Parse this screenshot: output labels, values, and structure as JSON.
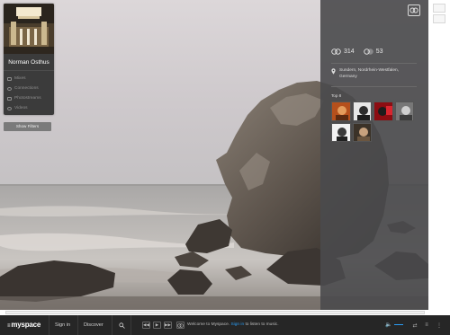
{
  "colors": {
    "accent": "#2a9df4",
    "panel": "#4a4a4c",
    "bar": "#262626"
  },
  "profile": {
    "name": "Norman Osthus",
    "menu": [
      {
        "label": "Mixes",
        "icon": "mixes-icon"
      },
      {
        "label": "Connections",
        "icon": "connections-icon"
      },
      {
        "label": "Photostreams",
        "icon": "photostreams-icon"
      },
      {
        "label": "Videos",
        "icon": "videos-icon"
      }
    ],
    "show_filters": "Show Filters"
  },
  "info_panel": {
    "connections_count": "314",
    "following_count": "53",
    "location": [
      "Sundern, Nordrhein-Westfalen,",
      "Germany"
    ],
    "top8_label": "Top 8",
    "top8": [
      {
        "icon": "friend-avatar-1"
      },
      {
        "icon": "friend-avatar-2"
      },
      {
        "icon": "friend-avatar-3"
      },
      {
        "icon": "friend-avatar-4"
      },
      {
        "icon": "friend-avatar-5"
      },
      {
        "icon": "friend-avatar-6"
      }
    ]
  },
  "bottom_bar": {
    "logo": "myspace",
    "nav": [
      "Sign in",
      "Discover"
    ],
    "welcome_prefix": "Welcome to Myspace.",
    "welcome_link": "Sign in",
    "welcome_suffix": "to listen to music."
  }
}
